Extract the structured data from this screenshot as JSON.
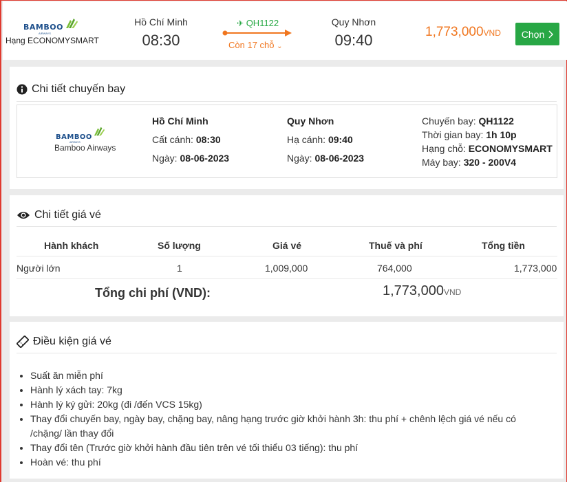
{
  "header": {
    "logo_text": "BAMBOO",
    "logo_sub": "AIRWAYS",
    "class_label": "Hạng ECONOMYSMART",
    "departure": {
      "city": "Hồ Chí Minh",
      "time": "08:30"
    },
    "arrival": {
      "city": "Quy Nhơn",
      "time": "09:40"
    },
    "flight_code": "QH1122",
    "seats_left": "Còn 17 chỗ",
    "price": "1,773,000",
    "currency": "VND",
    "select_label": "Chọn",
    "colors": {
      "accent_orange": "#f0761f",
      "accent_green": "#27a844",
      "brand_blue": "#1d4f8b",
      "frame_red": "#e03a2f"
    }
  },
  "flight_detail": {
    "title": "Chi tiết chuyến bay",
    "icon": "info-circle-icon",
    "airline": "Bamboo Airways",
    "departure": {
      "city": "Hồ Chí Minh",
      "takeoff_label": "Cất cánh:",
      "time": "08:30",
      "date_label": "Ngày:",
      "date": "08-06-2023"
    },
    "arrival": {
      "city": "Quy Nhơn",
      "landing_label": "Hạ cánh:",
      "time": "09:40",
      "date_label": "Ngày:",
      "date": "08-06-2023"
    },
    "info": {
      "flight_label": "Chuyến bay:",
      "flight": "QH1122",
      "duration_label": "Thời gian bay:",
      "duration": "1h 10p",
      "seat_class_label": "Hạng chỗ:",
      "seat_class": "ECONOMYSMART",
      "aircraft_label": "Máy bay:",
      "aircraft": "320 - 200V4"
    }
  },
  "price_detail": {
    "title": "Chi tiết giá vé",
    "icon": "eye-icon",
    "columns": [
      "Hành khách",
      "Số lượng",
      "Giá vé",
      "Thuế và phí",
      "Tổng tiền"
    ],
    "rows": [
      {
        "passenger": "Người lớn",
        "quantity": "1",
        "fare": "1,009,000",
        "tax": "764,000",
        "total": "1,773,000"
      }
    ],
    "total_label": "Tổng chi phí (VND):",
    "total_value": "1,773,000",
    "total_currency": "VND"
  },
  "fare_conditions": {
    "title": "Điều kiện giá vé",
    "icon": "ticket-icon",
    "items": [
      "Suất ăn miễn phí",
      "Hành lý xách tay: 7kg",
      "Hành lý ký gửi: 20kg (đi /đến VCS 15kg)",
      "Thay đổi chuyến bay, ngày bay, chặng bay, nâng hạng trước giờ khởi hành 3h: thu phí + chênh lệch giá vé nếu có /chặng/ lần thay đổi",
      "Thay đổi tên (Trước giờ khởi hành đầu tiên trên vé tối thiểu 03 tiếng): thu phí",
      "Hoàn vé: thu phí"
    ]
  }
}
